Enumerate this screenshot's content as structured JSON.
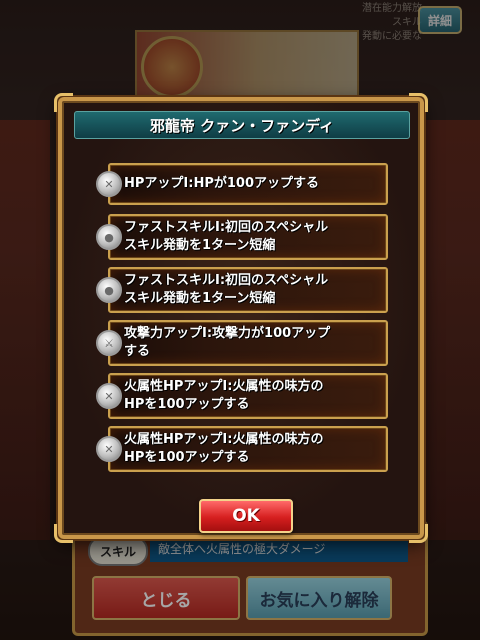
{
  "background": {
    "top_text_line1": "潜在能力解放",
    "top_text_line2": "スキル",
    "top_text_line3": "発動に必要な",
    "detail_button": "詳細",
    "skill_tag": "スキル",
    "skill_text": "敵全体へ火属性の極大ダメージ",
    "close_button": "とじる",
    "unfavorite_button": "お気に入り解除"
  },
  "modal": {
    "title": "邪龍帝 クァン・ファンディ",
    "abilities": [
      {
        "text": "HPアップⅠ:HPが100アップする"
      },
      {
        "text": "ファストスキルⅠ:初回のスペシャル\nスキル発動を1ターン短縮"
      },
      {
        "text": "ファストスキルⅠ:初回のスペシャル\nスキル発動を1ターン短縮"
      },
      {
        "text": "攻撃力アップⅠ:攻撃力が100アップ\nする"
      },
      {
        "text": "火属性HPアップⅠ:火属性の味方の\nHPを100アップする"
      },
      {
        "text": "火属性HPアップⅠ:火属性の味方の\nHPを100アップする"
      }
    ],
    "ok_button": "OK"
  },
  "colors": {
    "frame_gold": "#c9974a",
    "title_teal": "#1f6a6f",
    "ok_red": "#d61f1f"
  }
}
